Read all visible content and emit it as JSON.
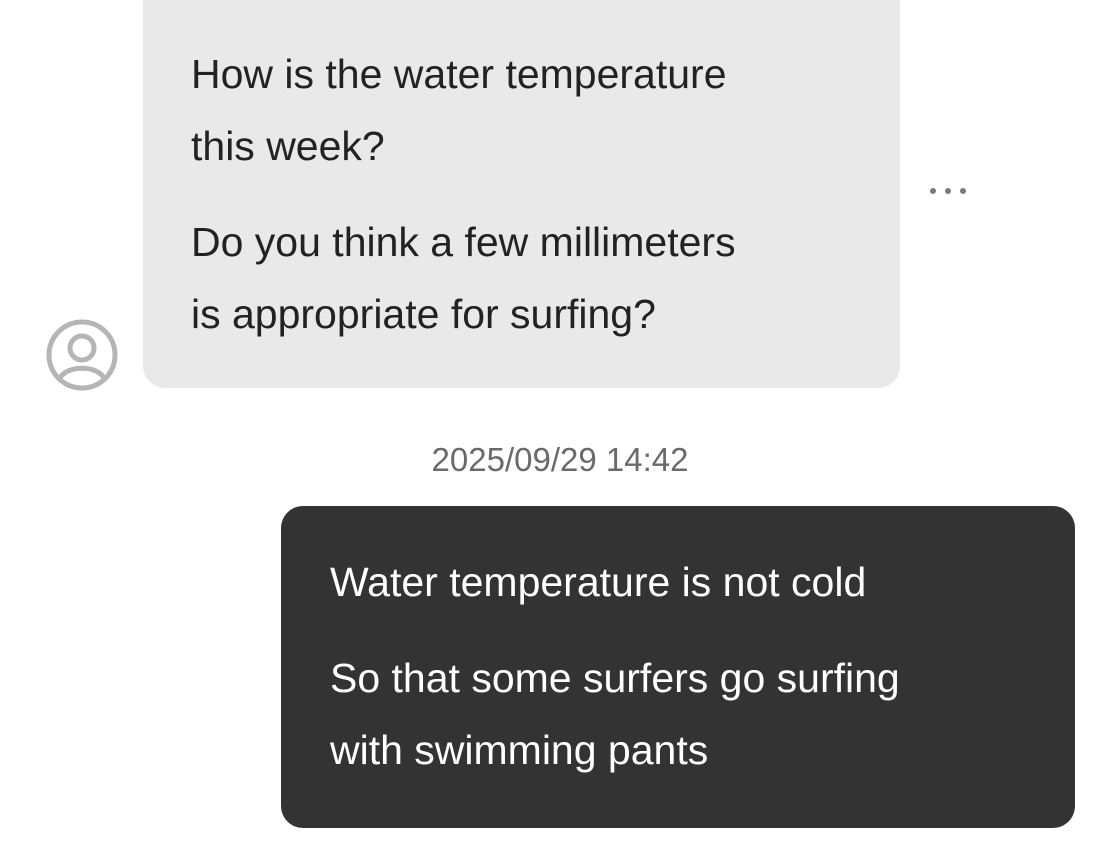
{
  "messages": {
    "incoming": {
      "paragraph_1_line_1": "How is the water temperature",
      "paragraph_1_line_2": "this week?",
      "paragraph_2_line_1": "Do you think a few millimeters",
      "paragraph_2_line_2": "is appropriate for surfing?",
      "avatar_icon": "user-circle-icon",
      "more_icon": "ellipsis-icon"
    },
    "timestamp": "2025/09/29 14:42",
    "outgoing": {
      "paragraph_1_line_1": "Water temperature is not cold",
      "paragraph_2_line_1": "So that some surfers go surfing",
      "paragraph_2_line_2": "with swimming pants"
    }
  },
  "colors": {
    "incoming_bubble": "#e9e9e9",
    "outgoing_bubble": "#333333",
    "timestamp_text": "#6a6a6a",
    "icon_gray": "#b5b5b5"
  }
}
